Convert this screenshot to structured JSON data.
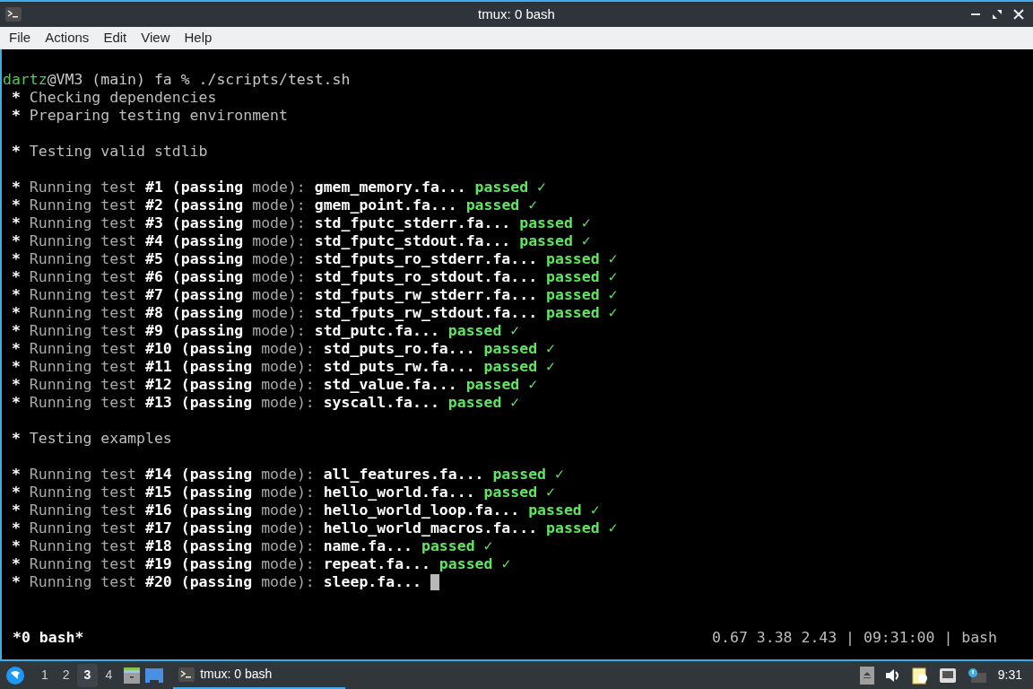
{
  "window": {
    "title": "tmux: 0 bash"
  },
  "menu": [
    "File",
    "Actions",
    "Edit",
    "View",
    "Help"
  ],
  "terminal": {
    "cursor_visible": true,
    "lines": [
      {
        "kind": "prompt",
        "user": "dartz",
        "text": "@VM3 (main) fa % ./scripts/test.sh"
      },
      {
        "kind": "info",
        "bullet": "*",
        "text": "Checking dependencies"
      },
      {
        "kind": "info",
        "bullet": "*",
        "text": "Preparing testing environment"
      },
      {
        "kind": "blank"
      },
      {
        "kind": "info",
        "bullet": "*",
        "text": "Testing valid stdlib"
      },
      {
        "kind": "blank"
      },
      {
        "kind": "test",
        "bullet": "*",
        "label": "Running test",
        "number": "#1",
        "mode": "(passing",
        "mode_label": "mode):",
        "file": "gmem_memory.fa...",
        "result": "passed ✓"
      },
      {
        "kind": "test",
        "bullet": "*",
        "label": "Running test",
        "number": "#2",
        "mode": "(passing",
        "mode_label": "mode):",
        "file": "gmem_point.fa...",
        "result": "passed ✓"
      },
      {
        "kind": "test",
        "bullet": "*",
        "label": "Running test",
        "number": "#3",
        "mode": "(passing",
        "mode_label": "mode):",
        "file": "std_fputc_stderr.fa...",
        "result": "passed ✓"
      },
      {
        "kind": "test",
        "bullet": "*",
        "label": "Running test",
        "number": "#4",
        "mode": "(passing",
        "mode_label": "mode):",
        "file": "std_fputc_stdout.fa...",
        "result": "passed ✓"
      },
      {
        "kind": "test",
        "bullet": "*",
        "label": "Running test",
        "number": "#5",
        "mode": "(passing",
        "mode_label": "mode):",
        "file": "std_fputs_ro_stderr.fa...",
        "result": "passed ✓"
      },
      {
        "kind": "test",
        "bullet": "*",
        "label": "Running test",
        "number": "#6",
        "mode": "(passing",
        "mode_label": "mode):",
        "file": "std_fputs_ro_stdout.fa...",
        "result": "passed ✓"
      },
      {
        "kind": "test",
        "bullet": "*",
        "label": "Running test",
        "number": "#7",
        "mode": "(passing",
        "mode_label": "mode):",
        "file": "std_fputs_rw_stderr.fa...",
        "result": "passed ✓"
      },
      {
        "kind": "test",
        "bullet": "*",
        "label": "Running test",
        "number": "#8",
        "mode": "(passing",
        "mode_label": "mode):",
        "file": "std_fputs_rw_stdout.fa...",
        "result": "passed ✓"
      },
      {
        "kind": "test",
        "bullet": "*",
        "label": "Running test",
        "number": "#9",
        "mode": "(passing",
        "mode_label": "mode):",
        "file": "std_putc.fa...",
        "result": "passed ✓"
      },
      {
        "kind": "test",
        "bullet": "*",
        "label": "Running test",
        "number": "#10",
        "mode": "(passing",
        "mode_label": "mode):",
        "file": "std_puts_ro.fa...",
        "result": "passed ✓"
      },
      {
        "kind": "test",
        "bullet": "*",
        "label": "Running test",
        "number": "#11",
        "mode": "(passing",
        "mode_label": "mode):",
        "file": "std_puts_rw.fa...",
        "result": "passed ✓"
      },
      {
        "kind": "test",
        "bullet": "*",
        "label": "Running test",
        "number": "#12",
        "mode": "(passing",
        "mode_label": "mode):",
        "file": "std_value.fa...",
        "result": "passed ✓"
      },
      {
        "kind": "test",
        "bullet": "*",
        "label": "Running test",
        "number": "#13",
        "mode": "(passing",
        "mode_label": "mode):",
        "file": "syscall.fa...",
        "result": "passed ✓"
      },
      {
        "kind": "blank"
      },
      {
        "kind": "info",
        "bullet": "*",
        "text": "Testing examples"
      },
      {
        "kind": "blank"
      },
      {
        "kind": "test",
        "bullet": "*",
        "label": "Running test",
        "number": "#14",
        "mode": "(passing",
        "mode_label": "mode):",
        "file": "all_features.fa...",
        "result": "passed ✓"
      },
      {
        "kind": "test",
        "bullet": "*",
        "label": "Running test",
        "number": "#15",
        "mode": "(passing",
        "mode_label": "mode):",
        "file": "hello_world.fa...",
        "result": "passed ✓"
      },
      {
        "kind": "test",
        "bullet": "*",
        "label": "Running test",
        "number": "#16",
        "mode": "(passing",
        "mode_label": "mode):",
        "file": "hello_world_loop.fa...",
        "result": "passed ✓"
      },
      {
        "kind": "test",
        "bullet": "*",
        "label": "Running test",
        "number": "#17",
        "mode": "(passing",
        "mode_label": "mode):",
        "file": "hello_world_macros.fa...",
        "result": "passed ✓"
      },
      {
        "kind": "test",
        "bullet": "*",
        "label": "Running test",
        "number": "#18",
        "mode": "(passing",
        "mode_label": "mode):",
        "file": "name.fa...",
        "result": "passed ✓"
      },
      {
        "kind": "test",
        "bullet": "*",
        "label": "Running test",
        "number": "#19",
        "mode": "(passing",
        "mode_label": "mode):",
        "file": "repeat.fa...",
        "result": "passed ✓"
      },
      {
        "kind": "test",
        "bullet": "*",
        "label": "Running test",
        "number": "#20",
        "mode": "(passing",
        "mode_label": "mode):",
        "file": "sleep.fa..."
      }
    ]
  },
  "tmux_status": {
    "window": "*0 bash*",
    "right": "0.67 3.38 2.43 | 09:31:00 | bash"
  },
  "taskbar": {
    "workspaces": [
      {
        "label": "1",
        "selected": false
      },
      {
        "label": "2",
        "selected": false
      },
      {
        "label": "3",
        "selected": true
      },
      {
        "label": "4",
        "selected": false
      }
    ],
    "task": {
      "label": "tmux: 0 bash",
      "selected": true
    },
    "clock": "9:31"
  }
}
